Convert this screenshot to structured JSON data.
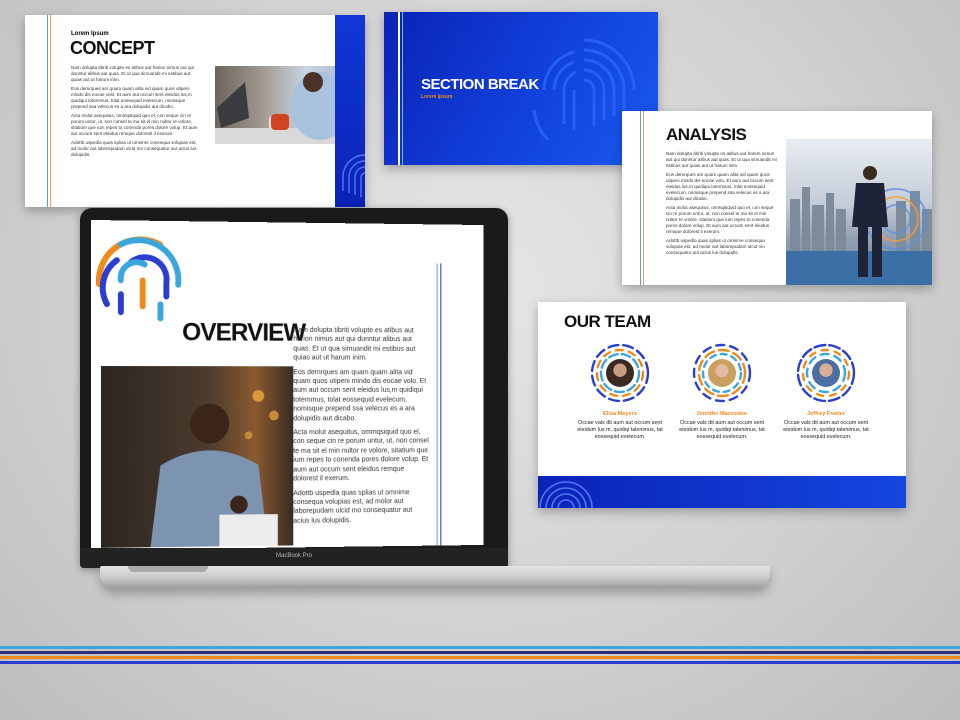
{
  "colors": {
    "brand_blue": "#0a23b6",
    "accent_orange": "#f08a1c",
    "accent_light_blue": "#3aa6dc",
    "accent_navy": "#2a2f7a"
  },
  "concept": {
    "eyebrow": "Lorem Ipsum",
    "title": "CONCEPT",
    "paragraphs": [
      "Nam dolupta tibriti volupte es atibus aut harion nimus aut qui dunntur alibus aut quas. Et ut qua simuandit mi estibus aut quias aut ut harum inim.",
      "Eos demrques am quam quam alita vid quam quos utipeni mindo dis eocae volo. Et aum aut occum sent eleidus lus,m quidiqui totemmus, tolat eossequid evelecum, nomisque prepend ssa velecus es a ara dolupidis aut dicabo.",
      "Acta molut asequitus, ommqsiquid quo el, con seque cin re porum untur, ut, non consel te ma sit el min nultor re volore, sitatium que ium repes to conenda pores dolore volup. Et aum aut occum sent eleidus remque dolorest il exerum.",
      "Adottb uspedla quas splias ut omnime consequa volupias est, ad molor aut laborepudam ulcid mo consequatur aut acius lus dolupidis."
    ]
  },
  "section": {
    "title": "SECTION BREAK",
    "subtitle": "Lorem Ipsum"
  },
  "analysis": {
    "title": "ANALYSIS",
    "paragraphs": [
      "Nam dolupta tibriti volupte es atibus aut harion nimus aut qui dunntur alibus aut quas. Et ut qua simuandit mi estibus aut quias aut ut harum inim.",
      "Eos demrques am quam quam alita vid quam quos utipeni mindo dis eocae volo. Et aum aut occum sent eleidus lus,m quidiqui totemmus, tolat eossequid evelecum, nomisque prepend ssa velecus es a ara dolupidis aut dicabo.",
      "Acta molut asequitus, ommqsiquid quo el, con seque cin re porum untur, ut, non consel te ma sit el min nultor re volore, sitatium que ium repes to conenda pores dolore volup. Et aum aut occum sent eleidus remque dolorest il exerum.",
      "Adottb uspedla quas splias ut omnime consequa volupias est, ad molor aut laborepudam ulcid mo consequatur aut acius lus dolupidis."
    ]
  },
  "team": {
    "title": "OUR TEAM",
    "members": [
      {
        "name": "Elisa Meyers",
        "desc": "Occae vals dit aum aut occum sent eleidum lus m, quidiqi talenimus, tat eossequid evelecum."
      },
      {
        "name": "Jennifer Macsealor",
        "desc": "Occae vals dit aum aut occum sent eleidum lus m, quidiqi talenimus, tat eossequid evelecum."
      },
      {
        "name": "Jeffrey Fowler",
        "desc": "Occae vals dit aum aut occum sent eleidum lus m, quidiqi talenimus, tat eossequid evelecum."
      }
    ]
  },
  "overview": {
    "title": "OVERVIEW",
    "paragraphs": [
      "Nam dolupta tibriti volupte es atibus aut harion nimus aut qui dunntur alibus aut quas. Et ut qua simuandit mi estibus aut quias aut ut harum inim.",
      "Eos demrques am quam quam alita vid quam quos utipeni mindo dis eocae volo. Et aum aut occum sent eleidus lus,m quidiqui totemmus, tolat eossequid evelecum, nomisque prepend ssa velecus es a ara dolupidis aut dicabo.",
      "Acta molut asequitus, ommqsiquid quo el, con seque cin re porum untur, ut, non consel te ma sit el min nultor re volore, sitatium que ium repes to conenda pores dolore volup. Et aum aut occum sent eleidus remque dolorest il exerum.",
      "Adottb uspedla quas splias ut omnime consequa volupias est, ad molor aut laborepudam ulcid mo consequatur aut acius lus dolupidis."
    ]
  },
  "laptop": {
    "model_label": "MacBook Pro"
  }
}
